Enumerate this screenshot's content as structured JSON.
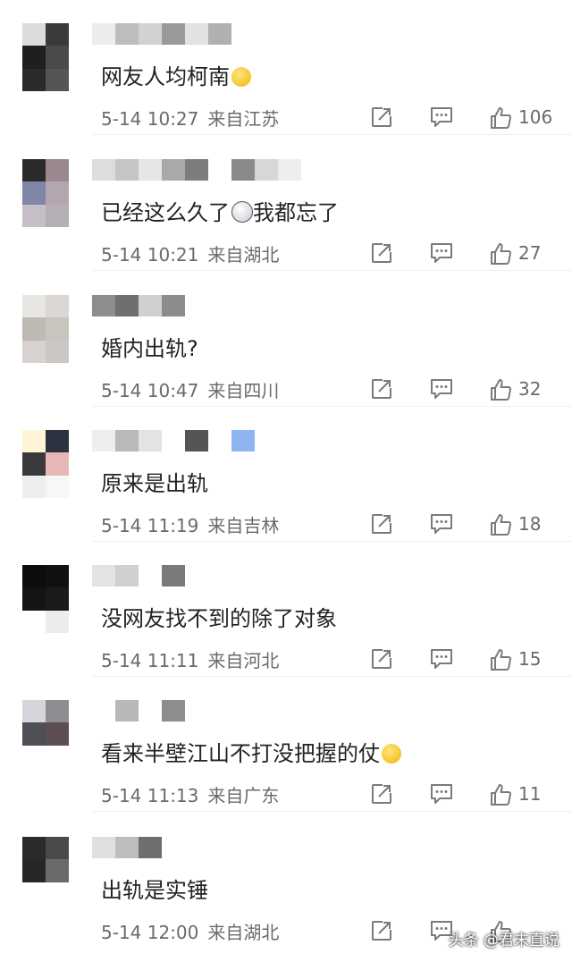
{
  "comments": [
    {
      "text": "网友人均柯南",
      "emoji": "face-smile-yellow",
      "time": "5-14 10:27",
      "location": "来自江苏",
      "likes": "106",
      "avatar": [
        "#dcdcdc",
        "#3a3a3a",
        "#1f1f1f",
        "#4a4a4a",
        "#2a2a2a",
        "#555555"
      ],
      "username_blocks": [
        "#ececec",
        "#bdbdbd",
        "#d2d2d2",
        "#9a9a9a",
        "#e2e2e2",
        "#b0b0b0"
      ]
    },
    {
      "text": "已经这么久了",
      "text2": "我都忘了",
      "emoji": "face-surprised",
      "time": "5-14 10:21",
      "location": "来自湖北",
      "likes": "27",
      "avatar": [
        "#2b2b2b",
        "#9b8790",
        "#7f86a6",
        "#b4a6b0",
        "#c7bfc7",
        "#b5aeb6"
      ],
      "username_blocks": [
        "#dddddd",
        "#c5c5c5",
        "#e6e6e6",
        "#a9a9a9",
        "#7d7d7d",
        "#ffffff",
        "#8a8a8a",
        "#d7d7d7",
        "#eeeeee"
      ]
    },
    {
      "text": "婚内出轨?",
      "time": "5-14 10:47",
      "location": "来自四川",
      "likes": "32",
      "avatar": [
        "#e8e6e2",
        "#d9d6d3",
        "#bdb9b3",
        "#c9c5bd",
        "#d8d2d0",
        "#ccc7c4"
      ],
      "username_blocks": [
        "#8d8d8d",
        "#6f6f6f",
        "#d0d0d0",
        "#8c8c8c"
      ]
    },
    {
      "text": "原来是出轨",
      "time": "5-14 11:19",
      "location": "来自吉林",
      "likes": "18",
      "avatar": [
        "#fff5d6",
        "#2c3340",
        "#3a3a3a",
        "#e8b7b7",
        "#eeeeee",
        "#f7f7f7"
      ],
      "username_blocks": [
        "#eeeeee",
        "#b9b9b9",
        "#e3e3e3",
        "#ffffff",
        "#555555",
        "#ffffff",
        "#8fb4f2"
      ]
    },
    {
      "text": "没网友找不到的除了对象",
      "time": "5-14 11:11",
      "location": "来自河北",
      "likes": "15",
      "avatar": [
        "#0c0c0c",
        "#111111",
        "#141414",
        "#1a1a1a",
        "#ffffff",
        "#ececec"
      ],
      "username_blocks": [
        "#e3e3e3",
        "#cfcfcf",
        "#ffffff",
        "#7a7a7a"
      ]
    },
    {
      "text": "看来半壁江山不打没把握的仗",
      "emoji": "face-smile-yellow",
      "time": "5-14 11:13",
      "location": "来自广东",
      "likes": "11",
      "avatar": [
        "#d5d5dc",
        "#8d8d93",
        "#4f4f55",
        "#5c4e52",
        "#ffffff",
        "#ffffff"
      ],
      "username_blocks": [
        "#ffffff",
        "#b8b8b8",
        "#ffffff",
        "#8d8d8d"
      ]
    },
    {
      "text": "出轨是实锤",
      "time": "5-14 12:00",
      "location": "来自湖北",
      "likes": "",
      "avatar": [
        "#2a2a2a",
        "#4a4a4a",
        "#262626",
        "#6a6a6a",
        "#ffffff",
        "#ffffff"
      ],
      "username_blocks": [
        "#e0e0e0",
        "#bdbdbd",
        "#6e6e6e"
      ]
    }
  ],
  "icons": {
    "share": "share-icon",
    "reply": "reply-icon",
    "like": "like-icon"
  },
  "watermark": "头条 @君末直说"
}
